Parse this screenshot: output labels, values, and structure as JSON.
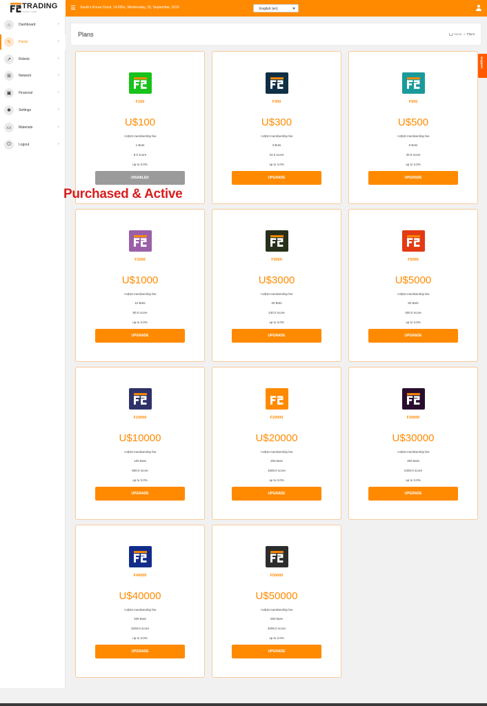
{
  "brand": {
    "name": "TRADING",
    "tagline": "FAMILY2BE"
  },
  "topbar": {
    "clock": "South's Korea Clock: 14:02hs, Wednesday, 25, September, 2019",
    "language": "English (en)"
  },
  "sidebar": {
    "items": [
      {
        "label": "Dashboard",
        "icon": "home-icon"
      },
      {
        "label": "Packs",
        "icon": "edit-icon"
      },
      {
        "label": "Robots",
        "icon": "chart-icon"
      },
      {
        "label": "Network",
        "icon": "network-icon"
      },
      {
        "label": "Financial",
        "icon": "money-icon"
      },
      {
        "label": "Settings",
        "icon": "gear-icon"
      },
      {
        "label": "Materials",
        "icon": "laptop-icon"
      },
      {
        "label": "Logout",
        "icon": "power-icon"
      }
    ]
  },
  "page": {
    "title": "Plans",
    "breadcrumb_home": "Home",
    "breadcrumb_sep": ">",
    "breadcrumb_current": "Plans"
  },
  "support_label": "Support",
  "stamp_text": "Purchased & Active",
  "plans": [
    {
      "name": "F100",
      "price": "U$100",
      "fee": "+U$10 membership fee",
      "bots": "1 Bots",
      "score": "8.0 score",
      "yield": "up to 3.0%",
      "button": "DISABLED",
      "color": "#17c21a"
    },
    {
      "name": "F300",
      "price": "U$300",
      "fee": "+U$10 membership fee",
      "bots": "3 Bots",
      "score": "24.0 score",
      "yield": "up to 3.0%",
      "button": "UPGRADE",
      "color": "#0f2f45"
    },
    {
      "name": "F500",
      "price": "U$500",
      "fee": "+U$10 membership fee",
      "bots": "5 Bots",
      "score": "40.0 score",
      "yield": "up to 3.0%",
      "button": "UPGRADE",
      "color": "#1a9a9a"
    },
    {
      "name": "F1000",
      "price": "U$1000",
      "fee": "+U$10 membership fee",
      "bots": "10 Bots",
      "score": "80.0 score",
      "yield": "up to 3.0%",
      "button": "UPGRADE",
      "color": "#9b5fa8"
    },
    {
      "name": "F3000",
      "price": "U$3000",
      "fee": "+U$10 membership fee",
      "bots": "30 Bots",
      "score": "240.0 score",
      "yield": "up to 3.0%",
      "button": "UPGRADE",
      "color": "#27301a"
    },
    {
      "name": "F5000",
      "price": "U$5000",
      "fee": "+U$10 membership fee",
      "bots": "50 Bots",
      "score": "400.0 score",
      "yield": "up to 3.0%",
      "button": "UPGRADE",
      "color": "#e23a12"
    },
    {
      "name": "F10000",
      "price": "U$10000",
      "fee": "+U$10 membership fee",
      "bots": "100 Bots",
      "score": "800.0 score",
      "yield": "up to 3.0%",
      "button": "UPGRADE",
      "color": "#2e3268"
    },
    {
      "name": "F20000",
      "price": "U$20000",
      "fee": "+U$10 membership fee",
      "bots": "200 Bots",
      "score": "1600.0 score",
      "yield": "up to 3.0%",
      "button": "UPGRADE",
      "color": "#ff8a00"
    },
    {
      "name": "F30000",
      "price": "U$30000",
      "fee": "+U$10 membership fee",
      "bots": "300 Bots",
      "score": "2400.0 score",
      "yield": "up to 3.0%",
      "button": "UPGRADE",
      "color": "#2a0e2e"
    },
    {
      "name": "F40000",
      "price": "U$40000",
      "fee": "+U$10 membership fee",
      "bots": "400 Bots",
      "score": "3200.0 score",
      "yield": "up to 3.0%",
      "button": "UPGRADE",
      "color": "#132c8a"
    },
    {
      "name": "F50000",
      "price": "U$50000",
      "fee": "+U$10 membership fee",
      "bots": "500 Bots",
      "score": "4000.0 score",
      "yield": "up to 3.0%",
      "button": "UPGRADE",
      "color": "#2c2c2c"
    }
  ],
  "colors": {
    "accent": "#ff8a00",
    "disabled": "#9b9b9b",
    "stamp": "#d81e1e"
  }
}
